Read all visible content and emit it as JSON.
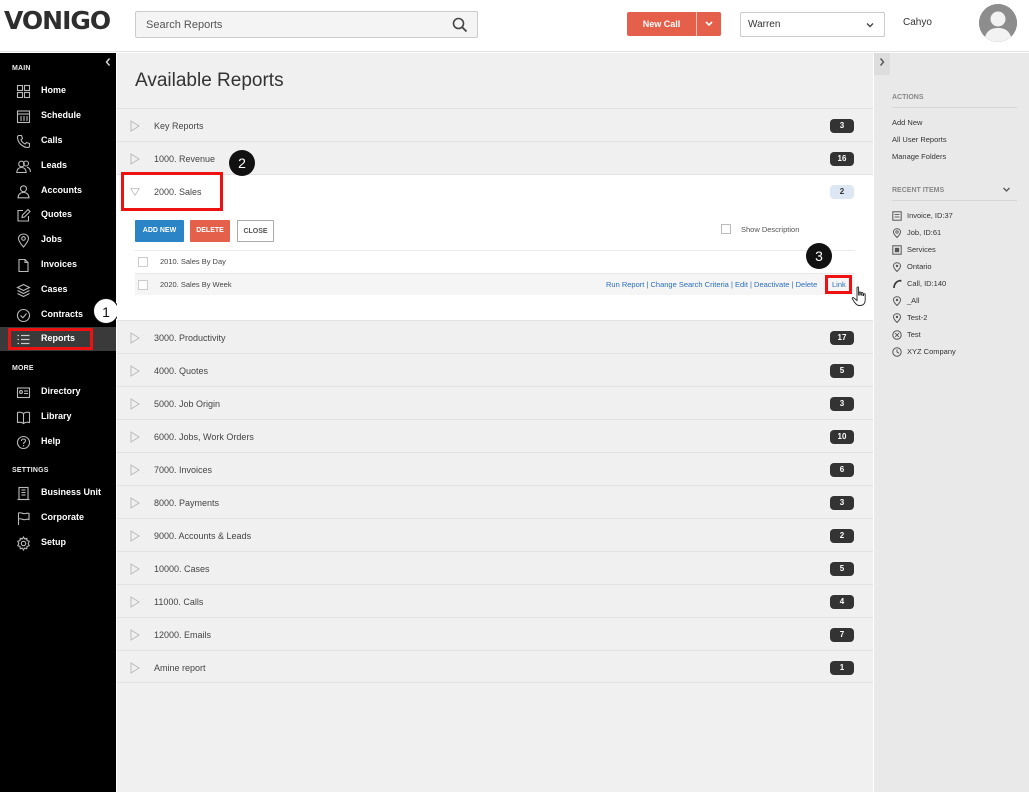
{
  "app": {
    "logo": "VONIGO"
  },
  "header": {
    "search_placeholder": "Search Reports",
    "new_call_label": "New Call",
    "user_select_value": "Warren",
    "username": "Cahyo"
  },
  "sidebar": {
    "main_title": "MAIN",
    "main_items": [
      {
        "label": "Home",
        "icon": "grid-icon"
      },
      {
        "label": "Schedule",
        "icon": "calendar-icon"
      },
      {
        "label": "Calls",
        "icon": "phone-icon"
      },
      {
        "label": "Leads",
        "icon": "people-icon"
      },
      {
        "label": "Accounts",
        "icon": "person-icon"
      },
      {
        "label": "Quotes",
        "icon": "edit-icon"
      },
      {
        "label": "Jobs",
        "icon": "pin-icon"
      },
      {
        "label": "Invoices",
        "icon": "document-icon"
      },
      {
        "label": "Cases",
        "icon": "layers-icon"
      },
      {
        "label": "Contracts",
        "icon": "check-circle-icon"
      },
      {
        "label": "Reports",
        "icon": "list-icon"
      }
    ],
    "more_title": "MORE",
    "more_items": [
      {
        "label": "Directory",
        "icon": "id-card-icon"
      },
      {
        "label": "Library",
        "icon": "book-icon"
      },
      {
        "label": "Help",
        "icon": "help-icon"
      }
    ],
    "settings_title": "SETTINGS",
    "settings_items": [
      {
        "label": "Business Unit",
        "icon": "building-icon"
      },
      {
        "label": "Corporate",
        "icon": "flag-icon"
      },
      {
        "label": "Setup",
        "icon": "gear-icon"
      }
    ]
  },
  "main": {
    "title": "Available Reports",
    "reports": [
      {
        "label": "Key Reports",
        "count": "3"
      },
      {
        "label": "1000. Revenue",
        "count": "16"
      },
      {
        "label": "2000. Sales",
        "count": "2"
      },
      {
        "label": "3000. Productivity",
        "count": "17"
      },
      {
        "label": "4000. Quotes",
        "count": "5"
      },
      {
        "label": "5000. Job Origin",
        "count": "3"
      },
      {
        "label": "6000. Jobs, Work Orders",
        "count": "10"
      },
      {
        "label": "7000. Invoices",
        "count": "6"
      },
      {
        "label": "8000. Payments",
        "count": "3"
      },
      {
        "label": "9000. Accounts & Leads",
        "count": "2"
      },
      {
        "label": "10000. Cases",
        "count": "5"
      },
      {
        "label": "11000. Calls",
        "count": "4"
      },
      {
        "label": "12000. Emails",
        "count": "7"
      },
      {
        "label": "Amine report",
        "count": "1"
      }
    ],
    "expanded": {
      "add_new": "ADD NEW",
      "delete": "DELETE",
      "close": "CLOSE",
      "show_description": "Show Description",
      "subreports": [
        "2010. Sales By Day",
        "2020. Sales By Week"
      ],
      "row_actions": {
        "run_report": "Run Report",
        "change_search": "Change Search Criteria",
        "edit": "Edit",
        "deactivate": "Deactivate",
        "delete": "Delete",
        "link": "Link",
        "separator": " | "
      }
    }
  },
  "callouts": [
    "1",
    "2",
    "3"
  ],
  "right_panel": {
    "actions_title": "ACTIONS",
    "actions": [
      "Add New",
      "All User Reports",
      "Manage Folders"
    ],
    "recent_title": "RECENT ITEMS",
    "recent": [
      {
        "label": "Invoice, ID:37",
        "icon": "invoice-icon"
      },
      {
        "label": "Job, ID:61",
        "icon": "pin-icon"
      },
      {
        "label": "Services",
        "icon": "square-icon"
      },
      {
        "label": "Ontario",
        "icon": "location-icon"
      },
      {
        "label": "Call, ID:140",
        "icon": "phone-icon"
      },
      {
        "label": "_All",
        "icon": "location-icon"
      },
      {
        "label": "Test-2",
        "icon": "location-icon"
      },
      {
        "label": "Test",
        "icon": "close-circle-icon"
      },
      {
        "label": "XYZ Company",
        "icon": "clock-icon"
      }
    ]
  },
  "colors": {
    "accent_red": "#e4604a",
    "accent_blue": "#2a84c6",
    "highlight_red": "#ee1111",
    "sidebar_bg": "#000000"
  }
}
